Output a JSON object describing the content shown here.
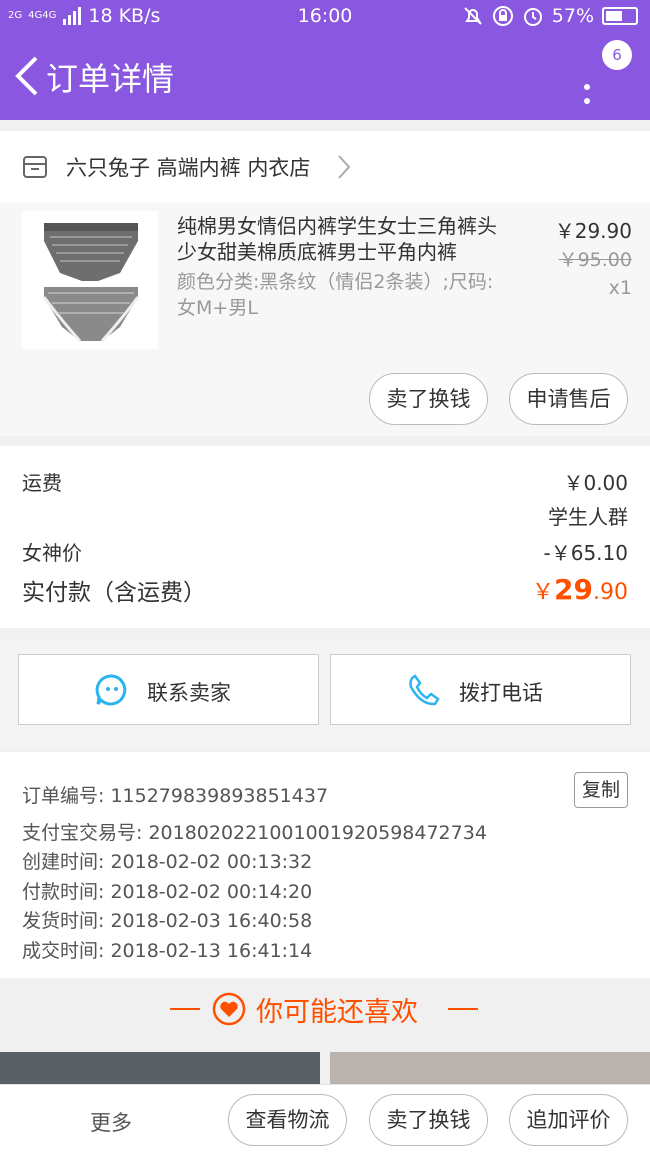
{
  "status_bar": {
    "signal_1": "2G",
    "signal_2": "4G",
    "signal_3": "4G",
    "speed": "18 KB/s",
    "time": "16:00",
    "battery": "57%",
    "battery_level": 0.57
  },
  "header": {
    "title": "订单详情",
    "badge": "6"
  },
  "shop": {
    "name": "六只兔子 高端内裤 内衣店"
  },
  "item": {
    "title": "纯棉男女情侣内裤学生女士三角裤头少女甜美棉质底裤男士平角内裤",
    "sku": "颜色分类:黑条纹（情侣2条装）;尺码:女M+男L",
    "price": "￥29.90",
    "original_price": "￥95.00",
    "quantity": "x1",
    "btn_sell": "卖了换钱",
    "btn_aftersale": "申请售后"
  },
  "costs": {
    "shipping_label": "运费",
    "shipping_value": "￥0.00",
    "group_label": "学生人群",
    "goddess_label": "女神价",
    "goddess_value": "-￥65.10",
    "paid_label": "实付款（含运费）",
    "paid_currency": "￥",
    "paid_int": "29",
    "paid_dec": ".90"
  },
  "contact": {
    "seller": "联系卖家",
    "phone": "拨打电话"
  },
  "order_info": {
    "order_no": "订单编号: 115279839893851437",
    "copy": "复制",
    "alipay_no": "支付宝交易号: 2018020221001001920598472734",
    "created": "创建时间: 2018-02-02 00:13:32",
    "paid": "付款时间: 2018-02-02 00:14:20",
    "shipped": "发货时间: 2018-02-03 16:40:58",
    "completed": "成交时间: 2018-02-13 16:41:14"
  },
  "recommend": {
    "title": "你可能还喜欢"
  },
  "bottom_bar": {
    "more": "更多",
    "logistics": "查看物流",
    "sell": "卖了换钱",
    "review": "追加评价"
  },
  "colors": {
    "header": "#8a57e0",
    "accent": "#ff5000",
    "contact_icon": "#2bb4f0"
  }
}
